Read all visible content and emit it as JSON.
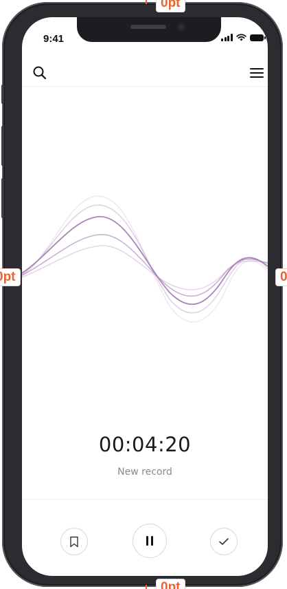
{
  "annotations": {
    "top": "0pt",
    "left": "0pt",
    "right": "0",
    "bottom": "0pt"
  },
  "status_bar": {
    "time": "9:41",
    "icons": [
      "cellular-signal-icon",
      "wifi-icon",
      "battery-icon"
    ]
  },
  "toolbar": {
    "left_icon": "search-icon",
    "right_icon": "hamburger-menu-icon"
  },
  "recording": {
    "elapsed": "00:04:20",
    "title": "New record"
  },
  "controls": [
    {
      "name": "bookmark-button",
      "icon": "bookmark-icon"
    },
    {
      "name": "pause-button",
      "icon": "pause-icon"
    },
    {
      "name": "done-button",
      "icon": "checkmark-icon"
    }
  ],
  "colors": {
    "wave": "#a77db5",
    "frame": "#2b2c30",
    "annotation": "#e8642c"
  }
}
